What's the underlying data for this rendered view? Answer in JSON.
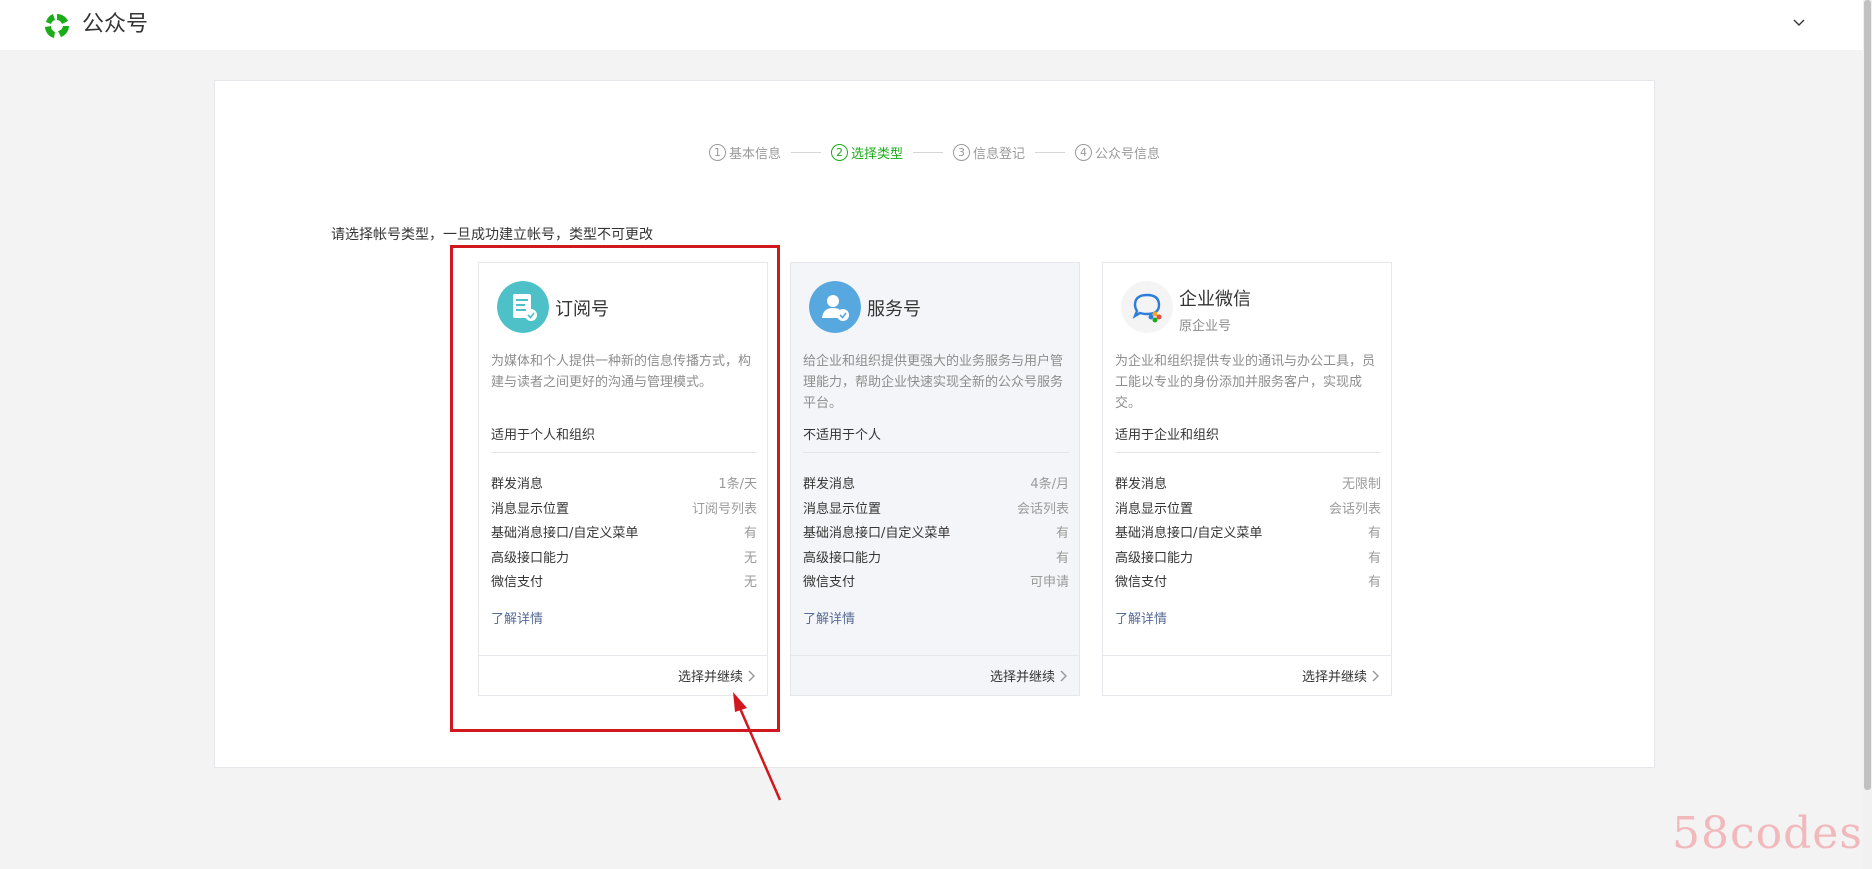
{
  "header": {
    "brand_name": "公众号",
    "brand_color": "#1aad19"
  },
  "steps": [
    {
      "num": "1",
      "label": "基本信息",
      "active": false
    },
    {
      "num": "2",
      "label": "选择类型",
      "active": true
    },
    {
      "num": "3",
      "label": "信息登记",
      "active": false
    },
    {
      "num": "4",
      "label": "公众号信息",
      "active": false
    }
  ],
  "instruction": "请选择帐号类型，一旦成功建立帐号，类型不可更改",
  "cards": [
    {
      "title": "订阅号",
      "icon": "subscription-doc-icon",
      "description": "为媒体和个人提供一种新的信息传播方式，构建与读者之间更好的沟通与管理模式。",
      "suitable": "适用于个人和组织",
      "features": [
        {
          "name": "群发消息",
          "value": "1条/天"
        },
        {
          "name": "消息显示位置",
          "value": "订阅号列表"
        },
        {
          "name": "基础消息接口/自定义菜单",
          "value": "有"
        },
        {
          "name": "高级接口能力",
          "value": "无"
        },
        {
          "name": "微信支付",
          "value": "无"
        }
      ],
      "learn_more": "了解详情",
      "action": "选择并继续"
    },
    {
      "title": "服务号",
      "icon": "service-person-icon",
      "description": "给企业和组织提供更强大的业务服务与用户管理能力，帮助企业快速实现全新的公众号服务平台。",
      "suitable": "不适用于个人",
      "features": [
        {
          "name": "群发消息",
          "value": "4条/月"
        },
        {
          "name": "消息显示位置",
          "value": "会话列表"
        },
        {
          "name": "基础消息接口/自定义菜单",
          "value": "有"
        },
        {
          "name": "高级接口能力",
          "value": "有"
        },
        {
          "name": "微信支付",
          "value": "可申请"
        }
      ],
      "learn_more": "了解详情",
      "action": "选择并继续"
    },
    {
      "title": "企业微信",
      "subtitle": "原企业号",
      "icon": "wework-chat-icon",
      "description": "为企业和组织提供专业的通讯与办公工具，员工能以专业的身份添加并服务客户，实现成交。",
      "suitable": "适用于企业和组织",
      "features": [
        {
          "name": "群发消息",
          "value": "无限制"
        },
        {
          "name": "消息显示位置",
          "value": "会话列表"
        },
        {
          "name": "基础消息接口/自定义菜单",
          "value": "有"
        },
        {
          "name": "高级接口能力",
          "value": "有"
        },
        {
          "name": "微信支付",
          "value": "有"
        }
      ],
      "learn_more": "了解详情",
      "action": "选择并继续"
    }
  ],
  "annotation": {
    "highlight_color": "#d0181e"
  },
  "watermark": "58codes"
}
